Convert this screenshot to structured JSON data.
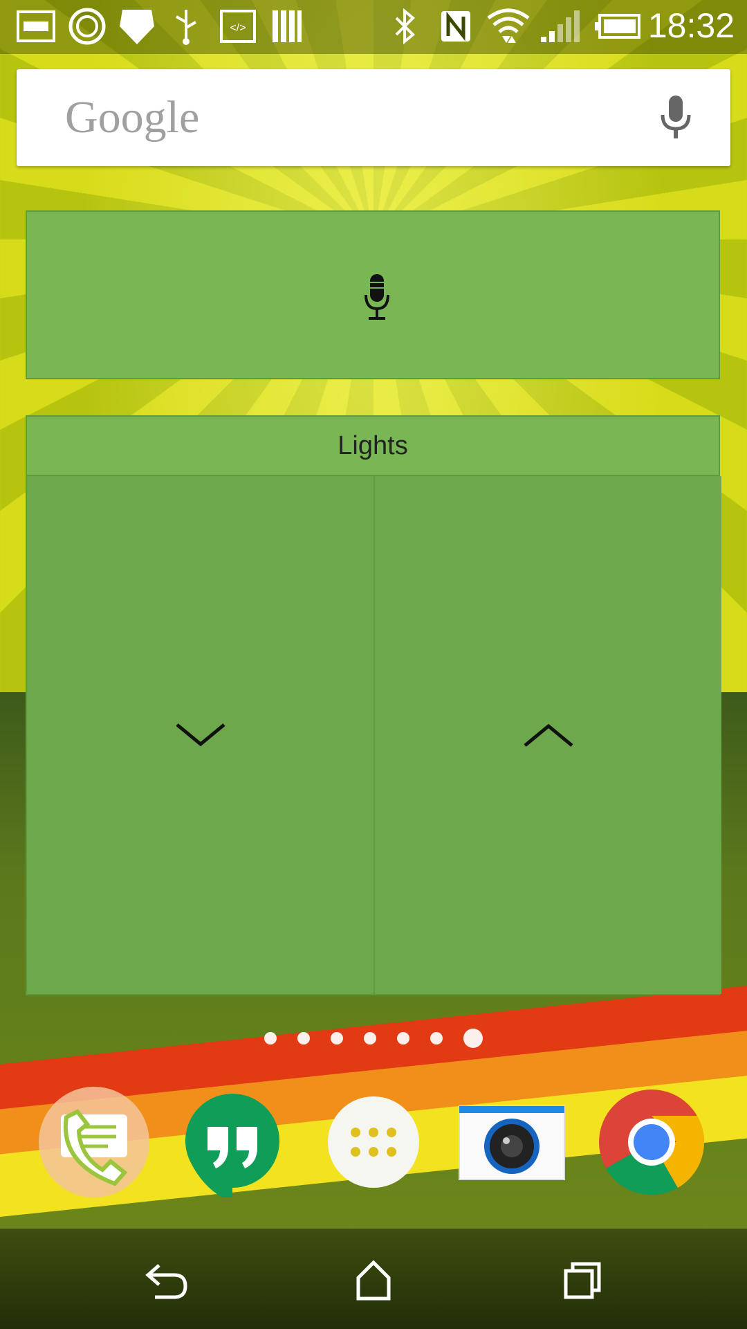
{
  "status_bar": {
    "time": "18:32",
    "icons": [
      "notification-icon",
      "sync-icon",
      "shield-icon",
      "usb-icon",
      "code-icon",
      "barcode-icon",
      "bluetooth-icon",
      "nfc-icon",
      "wifi-icon",
      "signal-icon",
      "battery-icon"
    ]
  },
  "search": {
    "logo_text": "Google"
  },
  "lights_widget": {
    "title": "Lights"
  },
  "page_indicator": {
    "count": 7,
    "active_index": 6
  },
  "dock": {
    "apps": [
      "phone-messages-app",
      "hangouts-app",
      "app-drawer",
      "camera-app",
      "chrome-app"
    ]
  },
  "colors": {
    "widget_green": "#78b753",
    "widget_dark_green": "#6ea84c"
  }
}
